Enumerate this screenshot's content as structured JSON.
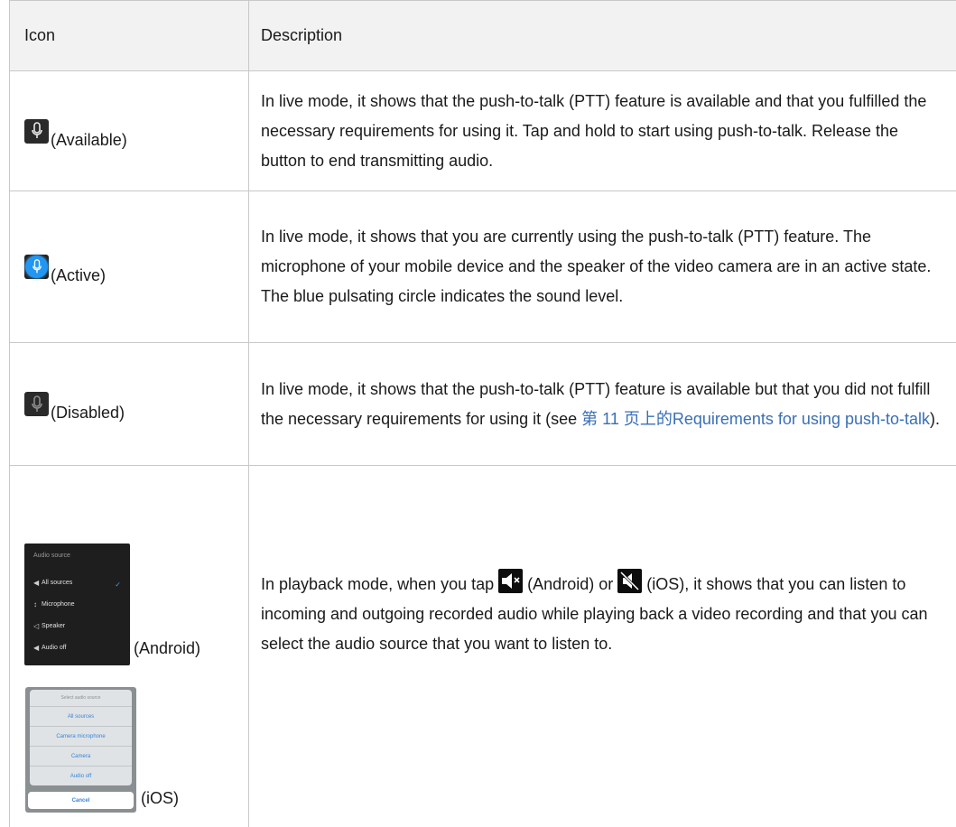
{
  "table": {
    "headers": {
      "icon": "Icon",
      "description": "Description"
    },
    "rows": [
      {
        "label": "(Available)",
        "icon": "microphone-available-icon",
        "description": "In live mode, it shows that the push-to-talk (PTT) feature is available and that you fulfilled the necessary requirements for using it. Tap and hold to start using push-to-talk. Release the button to end transmitting audio."
      },
      {
        "label": "(Active)",
        "icon": "microphone-active-icon",
        "description": "In live mode, it shows that you are currently using the push-to-talk (PTT) feature. The microphone of your mobile device and the speaker of the video camera are in an active state. The blue pulsating circle indicates the sound level."
      },
      {
        "label": "(Disabled)",
        "icon": "microphone-disabled-icon",
        "description_before": "In live mode, it shows that the push-to-talk (PTT) feature is available but that you did not fulfill the necessary requirements for using it (see ",
        "link_text": "第 11 页上的Requirements for using push-to-talk",
        "description_after": ")."
      },
      {
        "label_android": "(Android)",
        "label_ios": "(iOS)",
        "android_menu": {
          "title": "Audio source",
          "items": [
            "All sources",
            "Microphone",
            "Speaker",
            "Audio off"
          ]
        },
        "ios_menu": {
          "title": "Select audio source",
          "items": [
            "All sources",
            "Camera microphone",
            "Camera",
            "Audio off"
          ],
          "cancel": "Cancel"
        },
        "desc_part1": "In playback mode, when you tap ",
        "desc_part2": " (Android) or ",
        "desc_part3": " (iOS), it shows that you can listen to incoming and outgoing recorded audio while playing back a video recording and that you can select the audio source that you want to listen to."
      }
    ]
  },
  "colors": {
    "link": "#3a6fb5",
    "active_blue": "#2196f3",
    "header_bg": "#f2f2f2"
  }
}
